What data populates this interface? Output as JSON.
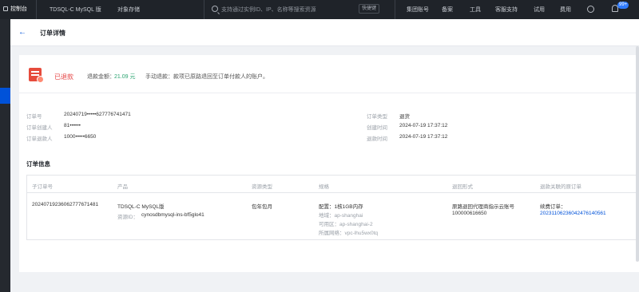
{
  "topnav": {
    "logo": "控制台",
    "product_tab": "TDSQL-C MySQL 版",
    "storage": "对象存储",
    "search_placeholder": "支持通过实例ID、IP、名称等搜索资源",
    "shortcut": "快捷键",
    "links": [
      "集团账号",
      "备案",
      "工具",
      "客服支持",
      "试用",
      "费用"
    ],
    "badge": "99+"
  },
  "header": {
    "title": "订单详情"
  },
  "status": {
    "label": "已退款",
    "amount_label": "退款金额：",
    "amount": "21.09 元",
    "note": "手动退款：款项已原路退回至订单付款人的账户。"
  },
  "info": {
    "left": [
      {
        "label": "订单号",
        "value": "20240719•••••627776741471"
      },
      {
        "label": "订单创建人",
        "value": "81••••••"
      },
      {
        "label": "订单退款人",
        "value": "1000•••••6650"
      }
    ],
    "right": [
      {
        "label": "订单类型",
        "value": "退货"
      },
      {
        "label": "创建时间",
        "value": "2024-07-19 17:37:12"
      },
      {
        "label": "退款时间",
        "value": "2024-07-19 17:37:12"
      }
    ]
  },
  "section_title": "订单信息",
  "table": {
    "headers": [
      "子订单号",
      "产品",
      "资源类型",
      "规格",
      "退回形式",
      "退款关联的原订单"
    ],
    "row": {
      "sub_order": "20240719236062777671481",
      "product": "TDSQL-C MySQL版",
      "resource_id_label": "资源ID：",
      "resource_id": "cynosdbmysql-ins-bf5glo41",
      "resource_type": "包年包月",
      "spec_config": "配置：1核1GB内存",
      "spec_region": "地域：ap-shanghai",
      "spec_zone": "可用区：ap-shanghai-2",
      "spec_network": "所属网络：vpc-lhu5wx0tq",
      "refund_form": "原路退回代理商指示云账号",
      "refund_account": "100000616650",
      "original_label": "续费订单：",
      "original_order": "20231106236042476140561"
    }
  }
}
